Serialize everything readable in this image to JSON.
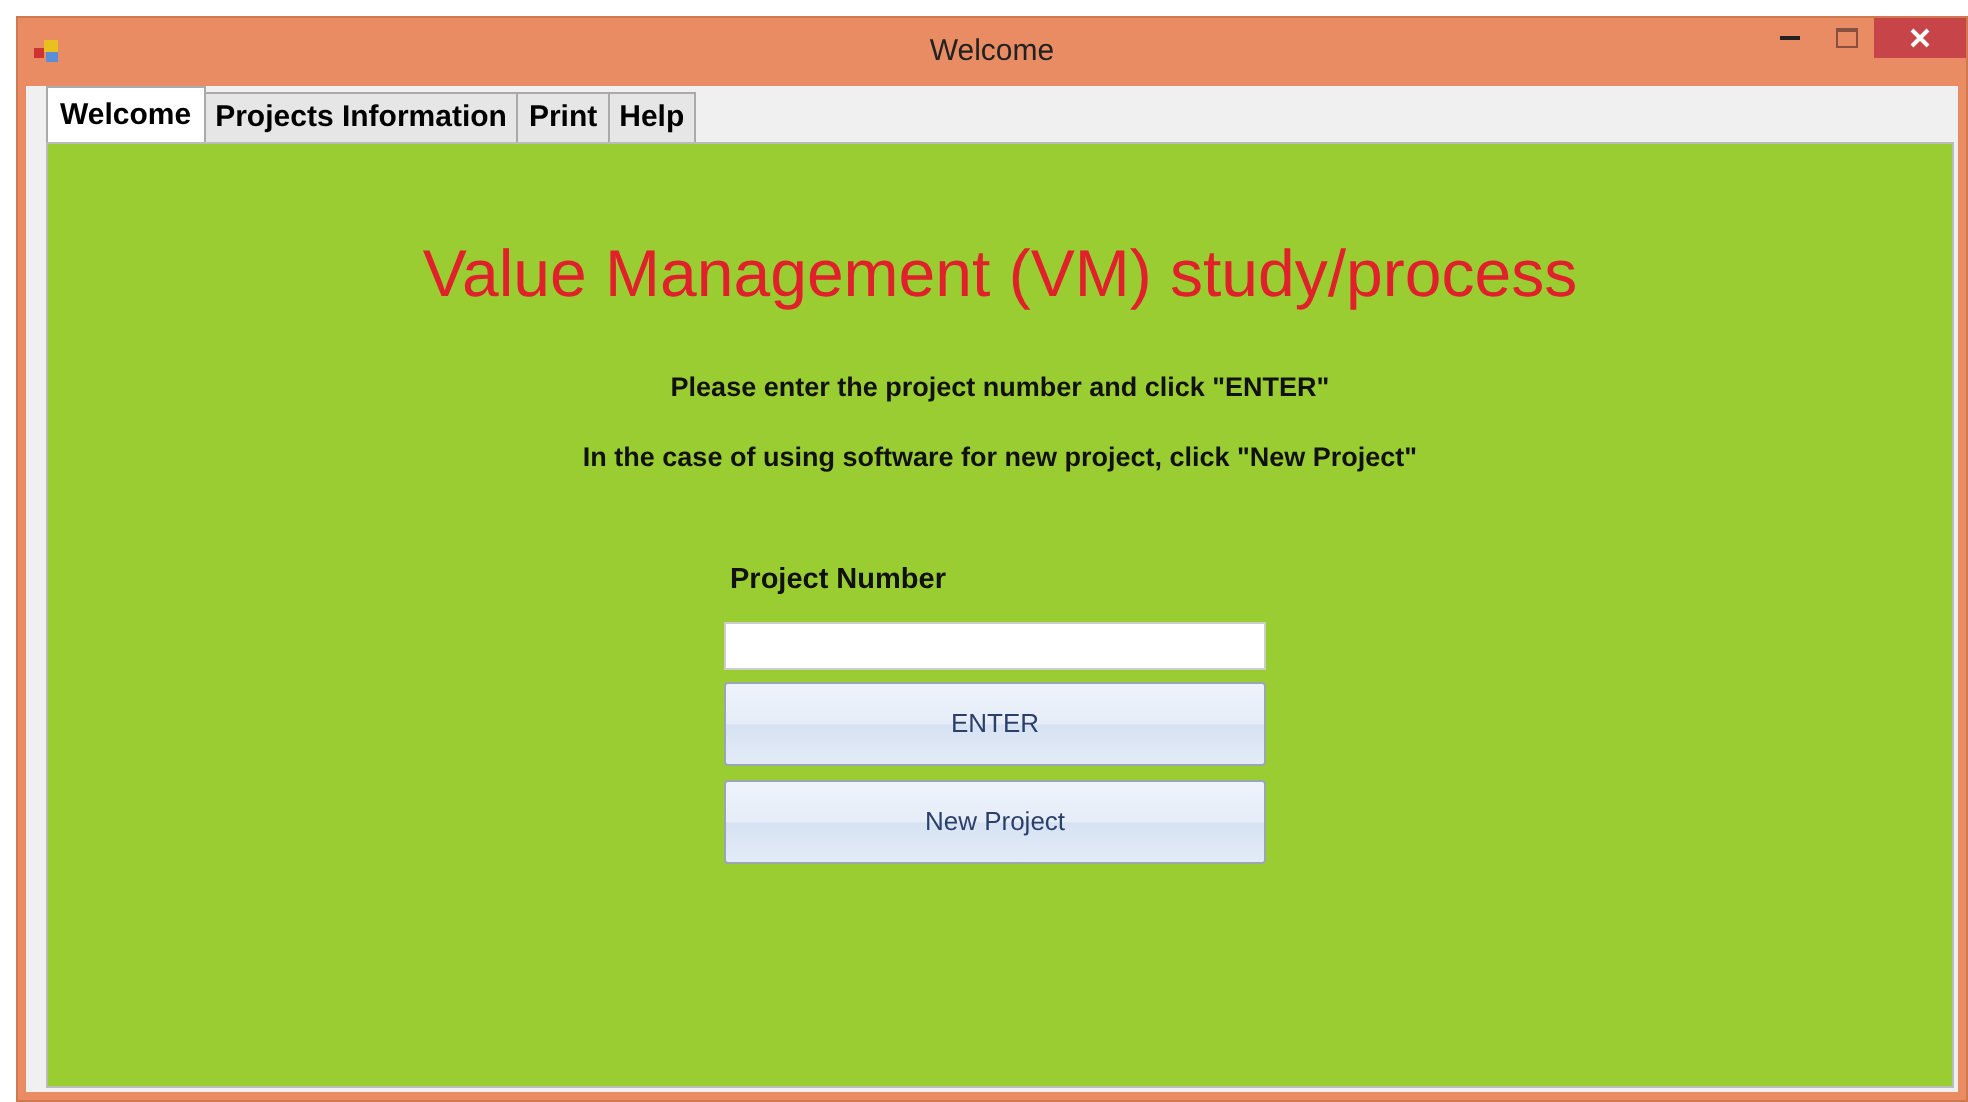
{
  "window": {
    "title": "Welcome"
  },
  "tabs": [
    {
      "label": "Welcome",
      "selected": true
    },
    {
      "label": "Projects Information",
      "selected": false
    },
    {
      "label": "Print",
      "selected": false
    },
    {
      "label": "Help",
      "selected": false
    }
  ],
  "heading": "Value Management (VM) study/process",
  "instructions": [
    "Please enter the project number and click \"ENTER\"",
    "In the case of using software for new project, click \"New Project\""
  ],
  "project_number": {
    "label": "Project Number"
  },
  "buttons": [
    "ENTER",
    "New Project"
  ]
}
